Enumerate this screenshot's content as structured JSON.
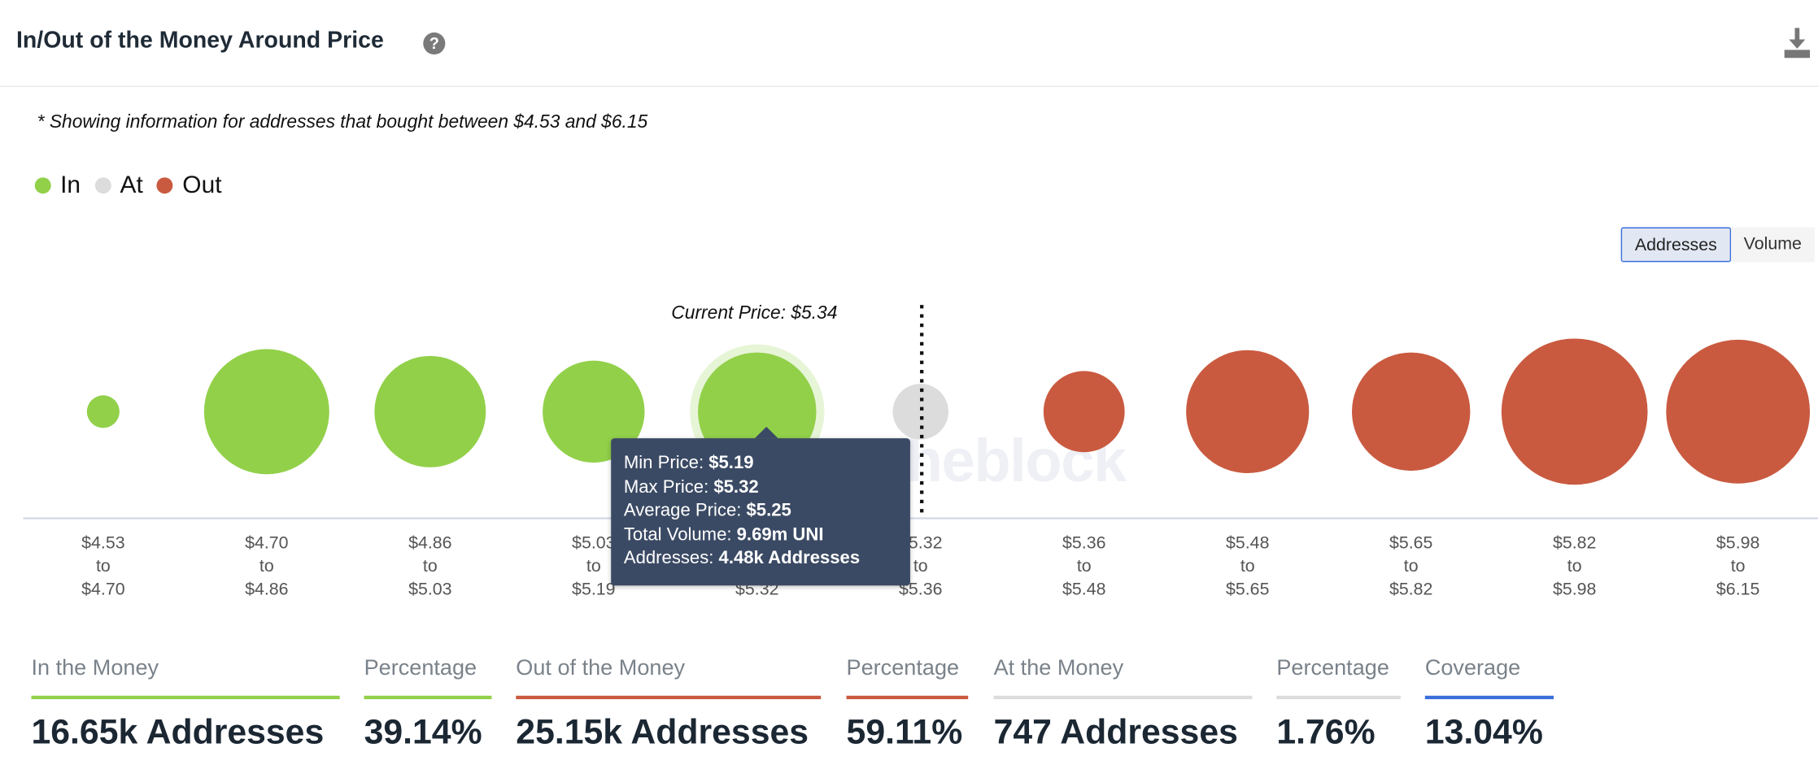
{
  "header": {
    "title": "In/Out of the Money Around Price",
    "help_icon": "question-circle-icon",
    "download_icon": "download-icon"
  },
  "note": "* Showing information for addresses that bought between $4.53 and $6.15",
  "toggle": {
    "options": [
      "Addresses",
      "Volume"
    ],
    "selected": "Addresses"
  },
  "colors": {
    "in": "#92d04a",
    "at": "#dcdcdc",
    "out": "#c95a40",
    "coverage": "#3a6fdc",
    "tooltip_bg": "#3b4a64"
  },
  "watermark": "theblock",
  "chart_data": {
    "type": "bubble",
    "legend": [
      {
        "name": "In",
        "color": "#92d04a"
      },
      {
        "name": "At",
        "color": "#dcdcdc"
      },
      {
        "name": "Out",
        "color": "#c95a40"
      }
    ],
    "legend_placement": "top-left",
    "current_price_label": "Current Price: $5.34",
    "current_price": 5.34,
    "size_metric": "addresses (k, estimated from bubble area)",
    "bins": [
      {
        "from": "$4.53",
        "to_word": "to",
        "to": "$4.70",
        "status": "in",
        "addresses_k": 0.34
      },
      {
        "from": "$4.70",
        "to_word": "to",
        "to": "$4.86",
        "status": "in",
        "addresses_k": 5.02
      },
      {
        "from": "$4.86",
        "to_word": "to",
        "to": "$5.03",
        "status": "in",
        "addresses_k": 3.97
      },
      {
        "from": "$5.03",
        "to_word": "to",
        "to": "$5.19",
        "status": "in",
        "addresses_k": 3.33
      },
      {
        "from": "$5.19",
        "to_word": "to",
        "to": "$5.32",
        "status": "in",
        "addresses_k": 4.48,
        "highlighted": true
      },
      {
        "from": "$5.32",
        "to_word": "to",
        "to": "$5.36",
        "status": "at",
        "addresses_k": 0.747
      },
      {
        "from": "$5.36",
        "to_word": "to",
        "to": "$5.48",
        "status": "out",
        "addresses_k": 2.11
      },
      {
        "from": "$5.48",
        "to_word": "to",
        "to": "$5.65",
        "status": "out",
        "addresses_k": 4.84
      },
      {
        "from": "$5.65",
        "to_word": "to",
        "to": "$5.82",
        "status": "out",
        "addresses_k": 4.48
      },
      {
        "from": "$5.82",
        "to_word": "to",
        "to": "$5.98",
        "status": "out",
        "addresses_k": 6.84
      },
      {
        "from": "$5.98",
        "to_word": "to",
        "to": "$6.15",
        "status": "out",
        "addresses_k": 6.62
      }
    ],
    "tooltip": {
      "rows": [
        {
          "label": "Min Price: ",
          "value": "$5.19"
        },
        {
          "label": "Max Price: ",
          "value": "$5.32"
        },
        {
          "label": "Average Price: ",
          "value": "$5.25"
        },
        {
          "label": "Total Volume: ",
          "value": "9.69m UNI"
        },
        {
          "label": "Addresses: ",
          "value": "4.48k Addresses"
        }
      ]
    }
  },
  "stats": [
    {
      "label": "In the Money",
      "value": "16.65k Addresses",
      "color": "#92d04a"
    },
    {
      "label": "Percentage",
      "value": "39.14%",
      "color": "#92d04a"
    },
    {
      "label": "Out of the Money",
      "value": "25.15k Addresses",
      "color": "#c95a40"
    },
    {
      "label": "Percentage",
      "value": "59.11%",
      "color": "#c95a40"
    },
    {
      "label": "At the Money",
      "value": "747 Addresses",
      "color": "#dcdcdc"
    },
    {
      "label": "Percentage",
      "value": "1.76%",
      "color": "#dcdcdc"
    },
    {
      "label": "Coverage",
      "value": "13.04%",
      "color": "#3a6fdc"
    }
  ]
}
